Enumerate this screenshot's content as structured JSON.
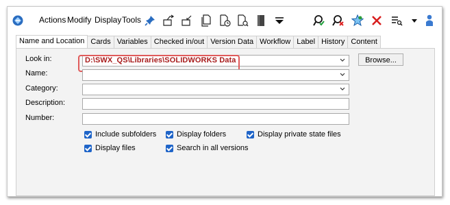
{
  "toolbar": {
    "menus": [
      "Actions",
      "Modify",
      "Display",
      "Tools"
    ],
    "icons": [
      "app-logo-icon",
      "pin-icon",
      "check-out-icon",
      "check-in-icon",
      "file-copy-icon",
      "file-clock-icon",
      "file-search-icon",
      "book-icon",
      "dropdown-triangle-icon",
      "find-green-icon",
      "find-red-icon",
      "favorite-star-icon",
      "close-icon",
      "list-filter-icon",
      "more-chevron-icon",
      "user-icon"
    ]
  },
  "tabs": [
    "Name and Location",
    "Cards",
    "Variables",
    "Checked in/out",
    "Version Data",
    "Workflow",
    "Label",
    "History",
    "Content"
  ],
  "form": {
    "look_in_label": "Look in:",
    "look_in_value": "D:\\SWX_QS\\Libraries\\SOLIDWORKS Data",
    "name_label": "Name:",
    "category_label": "Category:",
    "description_label": "Description:",
    "number_label": "Number:",
    "browse_label": "Browse..."
  },
  "options": {
    "include_subfolders": "Include subfolders",
    "display_folders": "Display folders",
    "display_private": "Display private state files",
    "display_files": "Display files",
    "search_all_versions": "Search in all versions"
  },
  "colors": {
    "checkbox": "#1e64c8",
    "path_text": "#a81c1c",
    "highlight": "#e05a5a"
  }
}
